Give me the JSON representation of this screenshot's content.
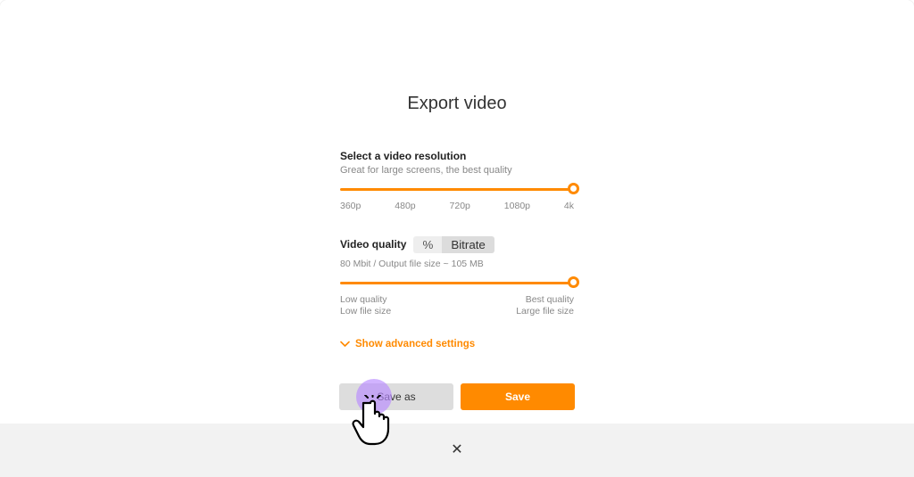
{
  "title": "Export video",
  "resolution": {
    "label": "Select a video resolution",
    "subtitle": "Great for large screens, the best quality",
    "ticks": [
      "360p",
      "480p",
      "720p",
      "1080p",
      "4k"
    ],
    "selected_index": 4
  },
  "quality": {
    "label": "Video quality",
    "mode_options": {
      "percent": "%",
      "bitrate": "Bitrate"
    },
    "active_mode": "bitrate",
    "readout": "80 Mbit / Output file size ~ 105 MB",
    "min": {
      "line1": "Low quality",
      "line2": "Low file size"
    },
    "max": {
      "line1": "Best quality",
      "line2": "Large file size"
    }
  },
  "advanced": {
    "label": "Show advanced settings"
  },
  "buttons": {
    "save_as": "Save as",
    "save": "Save"
  },
  "close_glyph": "✕",
  "colors": {
    "accent": "#ff8a00",
    "highlight": "#b98aff"
  }
}
